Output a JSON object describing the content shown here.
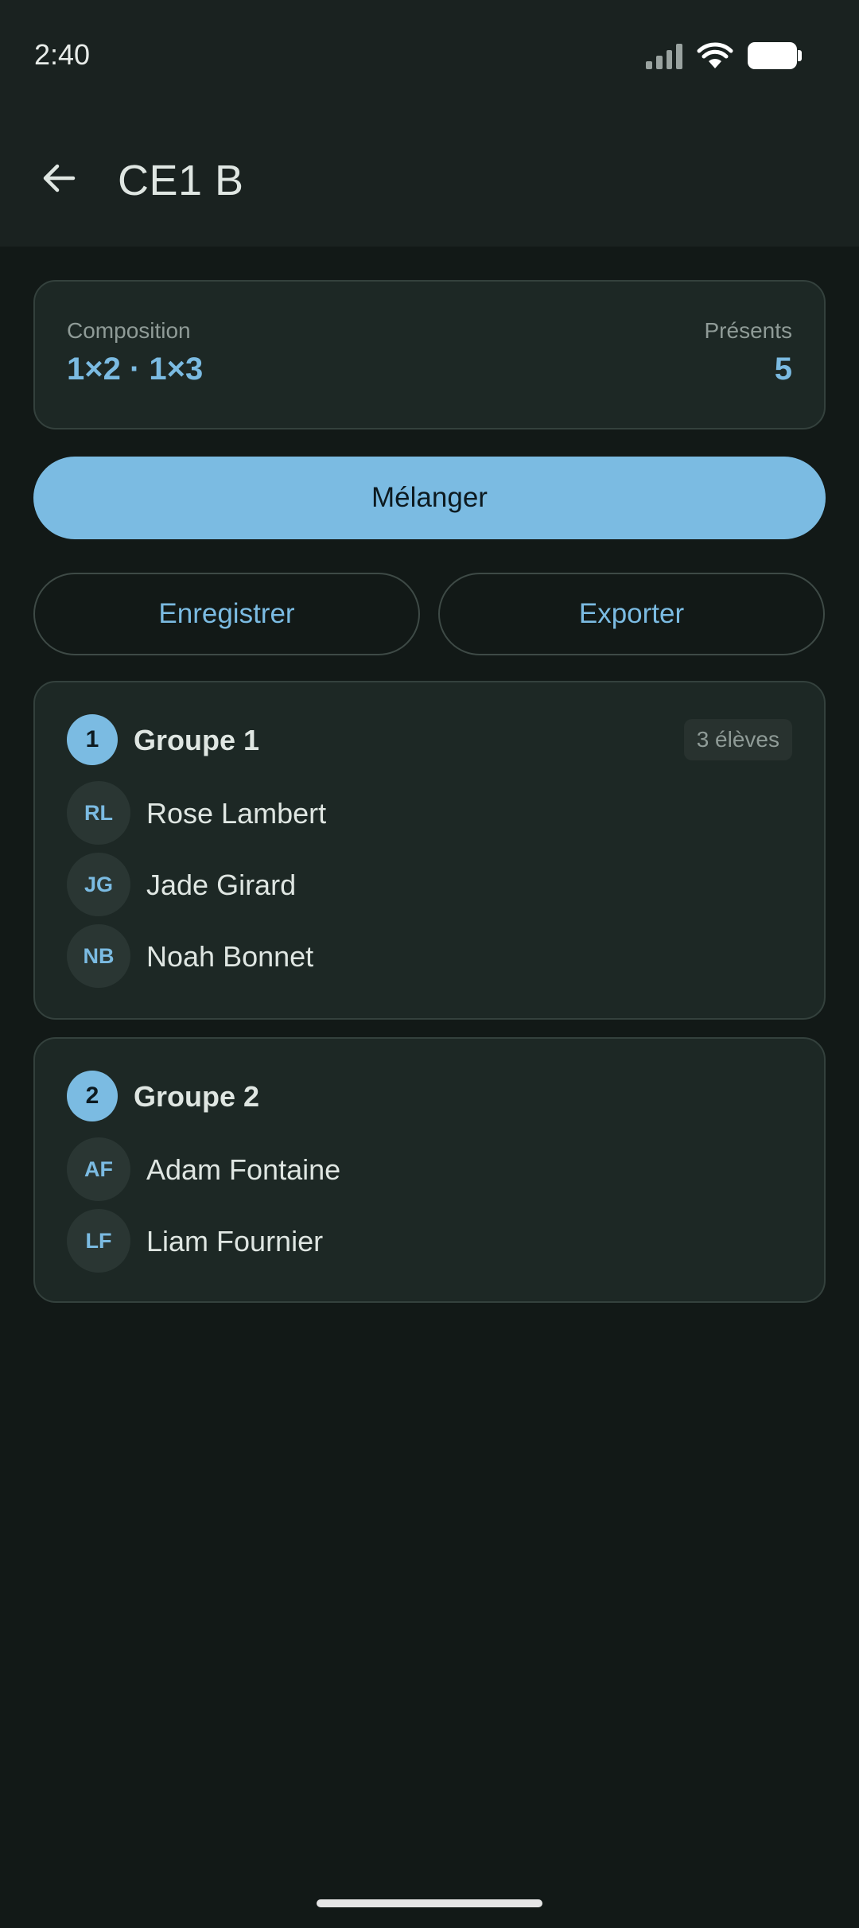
{
  "status_bar": {
    "time": "2:40"
  },
  "app_bar": {
    "title": "CE1 B"
  },
  "summary": {
    "composition_label": "Composition",
    "composition_value": "1×2 · 1×3",
    "present_label": "Présents",
    "present_value": "5"
  },
  "actions": {
    "shuffle_label": "Mélanger",
    "save_label": "Enregistrer",
    "export_label": "Exporter"
  },
  "groups": [
    {
      "number": "1",
      "name": "Groupe 1",
      "count": "3 élèves",
      "students": [
        {
          "initials": "RL",
          "name": "Rose Lambert"
        },
        {
          "initials": "JG",
          "name": "Jade Girard"
        },
        {
          "initials": "NB",
          "name": "Noah Bonnet"
        }
      ]
    },
    {
      "number": "2",
      "name": "Groupe 2",
      "students": [
        {
          "initials": "AF",
          "name": "Adam Fontaine"
        },
        {
          "initials": "LF",
          "name": "Liam Fournier"
        }
      ]
    }
  ],
  "colors": {
    "accent": "#7bbbe2",
    "background": "#121917",
    "surface": "#1d2825"
  }
}
